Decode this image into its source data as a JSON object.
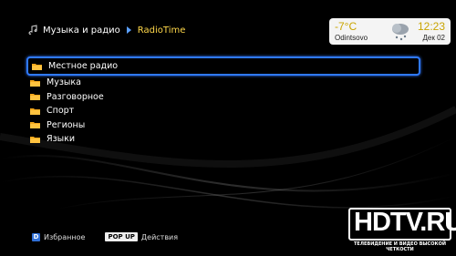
{
  "breadcrumb": {
    "parent": "Музыка и радио",
    "current": "RadioTime"
  },
  "weather": {
    "temperature": "-7°C",
    "city": "Odintsovo",
    "time": "12:23",
    "date": "Дек 02",
    "icon": "snow-cloud-icon"
  },
  "list": {
    "items": [
      {
        "label": "Местное радио",
        "icon": "folder-icon",
        "selected": true
      },
      {
        "label": "Музыка",
        "icon": "folder-icon",
        "selected": false
      },
      {
        "label": "Разговорное",
        "icon": "folder-icon",
        "selected": false
      },
      {
        "label": "Спорт",
        "icon": "folder-icon",
        "selected": false
      },
      {
        "label": "Регионы",
        "icon": "folder-icon",
        "selected": false
      },
      {
        "label": "Языки",
        "icon": "folder-icon",
        "selected": false
      }
    ]
  },
  "footer": {
    "favorites_key": "D",
    "favorites_label": "Избранное",
    "popup_key": "POP UP",
    "actions_label": "Действия"
  },
  "watermark": {
    "text": "HDTV.RU",
    "tagline": "ТЕЛЕВИДЕНИЕ И ВИДЕО ВЫСОКОЙ ЧЕТКОСТИ"
  },
  "colors": {
    "accent": "#2f79ff",
    "highlight_text": "#ffd84a"
  }
}
